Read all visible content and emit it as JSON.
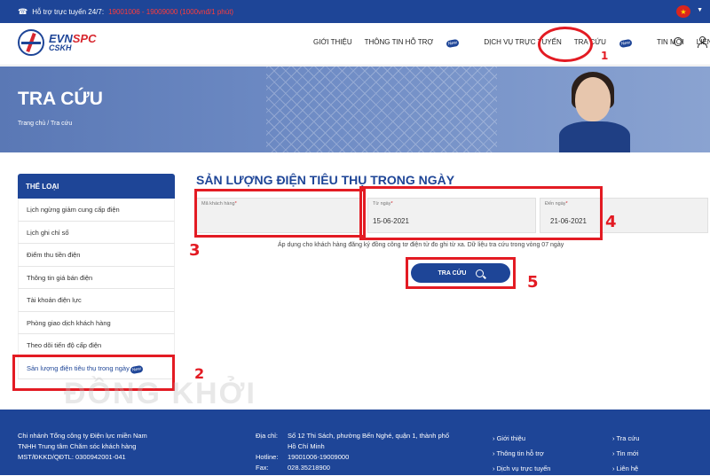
{
  "topbar": {
    "support_label": "Hỗ trợ trực tuyến 24/7:",
    "hotline": "19001006 - 19009000 (1000vnđ/1 phút)"
  },
  "logo": {
    "brand_evn": "EVN",
    "brand_spc": "SPC",
    "brand_cskh": "CSKH"
  },
  "nav": {
    "items": [
      {
        "label": "GIỚI THIỆU"
      },
      {
        "label": "THÔNG TIN HỖ TRỢ",
        "badge": "New"
      },
      {
        "label": "DỊCH VỤ TRỰC TUYẾN"
      },
      {
        "label": "TRA CỨU",
        "badge": "New"
      },
      {
        "label": "TIN MỚI"
      },
      {
        "label": "LIÊN HỆ"
      }
    ]
  },
  "hero": {
    "title": "TRA CỨU",
    "breadcrumb": [
      "Trang chủ",
      "/",
      "Tra cứu"
    ]
  },
  "sidebar": {
    "title": "THỂ LOẠI",
    "items": [
      "Lịch ngừng giảm cung cấp điện",
      "Lịch ghi chỉ số",
      "Điểm thu tiền điện",
      "Thông tin giá bán điện",
      "Tài khoản điện lực",
      "Phòng giao dịch khách hàng",
      "Theo dõi tiến độ cấp điện",
      "Sản lượng điện tiêu thụ trong ngày"
    ],
    "active_badge": "New"
  },
  "main": {
    "title": "SẢN LƯỢNG ĐIỆN TIÊU THỤ TRONG NGÀY",
    "fields": [
      {
        "label": "Mã khách hàng",
        "value": ""
      },
      {
        "label": "Từ ngày",
        "value": "15-06-2021"
      },
      {
        "label": "Đến ngày",
        "value": "21-06-2021"
      }
    ],
    "note": "Áp dụng cho khách hàng đăng ký đồng công tơ điện tử đo ghi từ xa. Dữ liệu tra cứu trong vòng 07 ngày",
    "search_button": "TRA CỨU"
  },
  "annotations": [
    "1",
    "2",
    "3",
    "4",
    "5"
  ],
  "watermark": "ĐỒNG KHỞI",
  "footer": {
    "org_line1": "Chi nhánh Tổng công ty Điện lực miền Nam",
    "org_line2": "TNHH Trung tâm Chăm sóc khách hàng",
    "org_line3": "MST/ĐKKD/QĐTL: 0300942001-041",
    "address_label": "Địa chỉ:",
    "address": "Số 12 Thi Sách, phường Bến Nghé, quận 1, thành phố Hồ Chí Minh",
    "hotline_label": "Hotline:",
    "hotline": "19001006-19009000",
    "fax_label": "Fax:",
    "fax": "028.35218900",
    "links_col1": [
      "Giới thiệu",
      "Thông tin hỗ trợ",
      "Dịch vụ trực tuyến"
    ],
    "links_col2": [
      "Tra cứu",
      "Tin mới",
      "Liên hệ"
    ]
  },
  "colors": {
    "primary": "#1e4597",
    "annotation": "#e31b23",
    "hotline": "#ff3b3b"
  }
}
